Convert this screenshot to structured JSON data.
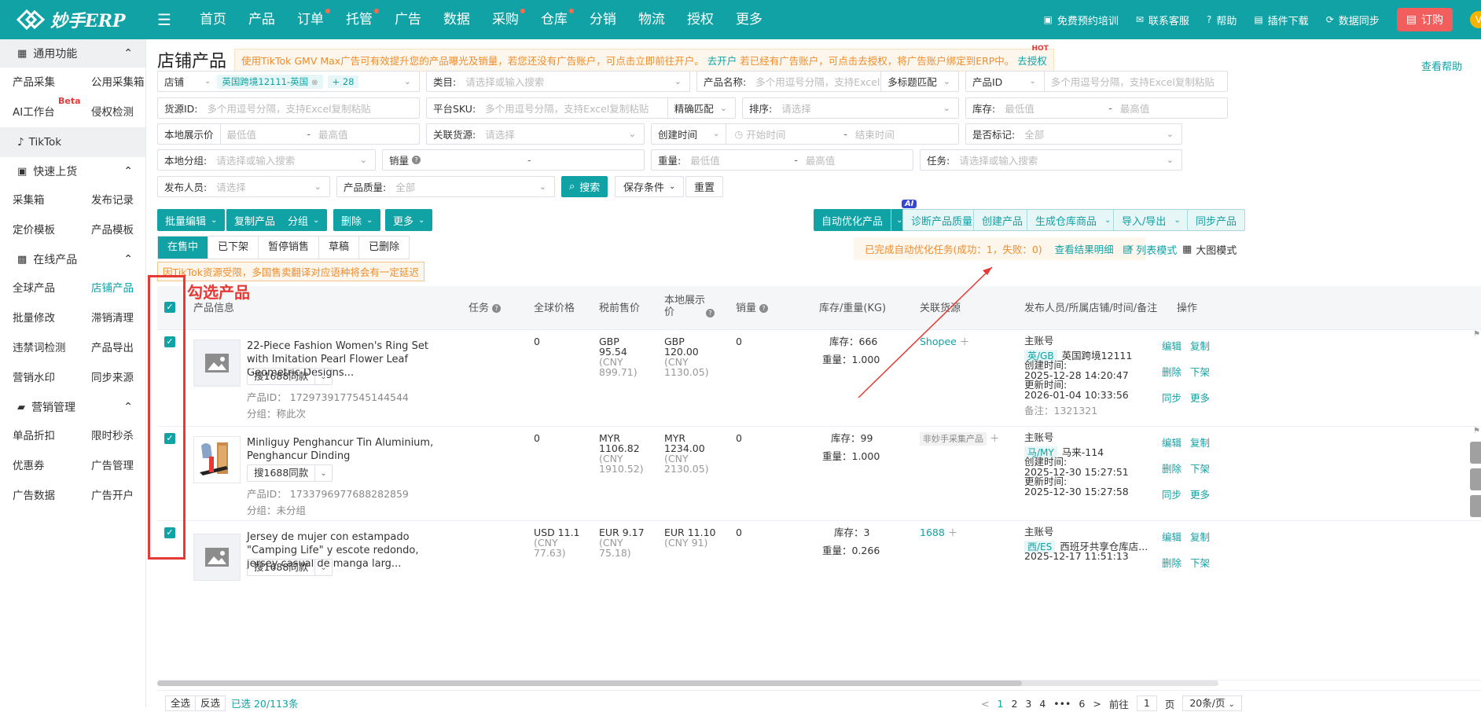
{
  "brand": {
    "name": "妙手ERP"
  },
  "nav": [
    {
      "label": "首页",
      "dot": false
    },
    {
      "label": "产品",
      "dot": false
    },
    {
      "label": "订单",
      "dot": true
    },
    {
      "label": "托管",
      "dot": true
    },
    {
      "label": "广告",
      "dot": false
    },
    {
      "label": "数据",
      "dot": false
    },
    {
      "label": "采购",
      "dot": true
    },
    {
      "label": "仓库",
      "dot": true
    },
    {
      "label": "分销",
      "dot": false
    },
    {
      "label": "物流",
      "dot": false
    },
    {
      "label": "授权",
      "dot": false
    },
    {
      "label": "更多",
      "dot": false
    }
  ],
  "top_right": {
    "training": "免费预约培训",
    "service": "联系客服",
    "help": "帮助",
    "plugin": "插件下载",
    "sync": "数据同步",
    "order": "订购",
    "avatar": "V"
  },
  "sidebar": {
    "common": "通用功能",
    "common_items": [
      "产品采集",
      "公用采集箱",
      "AI工作台",
      "侵权检测"
    ],
    "beta": "Beta",
    "platform": "TikTok",
    "quick": "快速上货",
    "quick_items": [
      "采集箱",
      "发布记录",
      "定价模板",
      "产品模板"
    ],
    "online": "在线产品",
    "online_items": [
      "全球产品",
      "店铺产品",
      "批量修改",
      "滞销清理",
      "违禁词检测",
      "产品导出",
      "营销水印",
      "同步来源"
    ],
    "marketing": "营销管理",
    "marketing_items": [
      "单品折扣",
      "限时秒杀",
      "优惠券",
      "广告管理",
      "广告数据",
      "广告开户"
    ]
  },
  "page": {
    "title": "店铺产品",
    "banner_pre": "使用TikTok GMV Max广告可有效提升您的产品曝光及销量，若您还没有广告账户，可点击立即前往开户。",
    "banner_link1": "去开户",
    "banner_mid": " 若已经有广告账户，可点击去授权，将广告账户绑定到ERP中。",
    "banner_link2": "去授权",
    "hot": "HOT",
    "view_help": "查看帮助"
  },
  "filters": {
    "shop": {
      "label": "店铺",
      "tag": "英国跨境12111-英国",
      "more": "+ 28"
    },
    "category": {
      "label": "类目:",
      "placeholder": "请选择或输入搜索"
    },
    "product_name": {
      "label": "产品名称:",
      "placeholder": "多个用逗号分隔，支持Excel复制粘",
      "mode": "多标题匹配"
    },
    "product_id": {
      "label": "产品ID",
      "placeholder": "多个用逗号分隔，支持Excel复制粘贴"
    },
    "source_id": {
      "label": "货源ID:",
      "placeholder": "多个用逗号分隔，支持Excel复制粘贴"
    },
    "platform_sku": {
      "label": "平台SKU:",
      "placeholder": "多个用逗号分隔，支持Excel复制粘贴",
      "mode": "精确匹配"
    },
    "sort": {
      "label": "排序:",
      "placeholder": "请选择"
    },
    "stock": {
      "label": "库存:",
      "min": "最低值",
      "max": "最高值"
    },
    "local_price": {
      "label": "本地展示价",
      "min": "最低值",
      "max": "最高值"
    },
    "linked_source": {
      "label": "关联货源:",
      "placeholder": "请选择"
    },
    "created_time": {
      "label": "创建时间",
      "start": "开始时间",
      "end": "结束时间"
    },
    "marked": {
      "label": "是否标记:",
      "value": "全部"
    },
    "local_group": {
      "label": "本地分组:",
      "placeholder": "请选择或输入搜索"
    },
    "sales": {
      "label": "销量"
    },
    "weight": {
      "label": "重量:",
      "min": "最低值",
      "max": "最高值"
    },
    "task": {
      "label": "任务:",
      "placeholder": "请选择或输入搜索"
    },
    "publisher": {
      "label": "发布人员:",
      "placeholder": "请选择"
    },
    "quality": {
      "label": "产品质量:",
      "value": "全部"
    },
    "search_btn": "搜索",
    "save_cond": "保存条件",
    "reset": "重置"
  },
  "actions": {
    "batch_edit": "批量编辑",
    "copy": "复制产品",
    "group": "分组",
    "delete": "删除",
    "more": "更多",
    "auto_opt": "自动优化产品",
    "ai": "AI",
    "diagnose": "诊断产品质量",
    "create": "创建产品",
    "gen_wh": "生成仓库商品",
    "import_export": "导入/导出",
    "sync_product": "同步产品"
  },
  "tabs": [
    "在售中",
    "已下架",
    "暂停销售",
    "草稿",
    "已删除"
  ],
  "notice": "因TikTok资源受限，多国售卖翻译对应语种将会有一定延迟",
  "done_msg": {
    "text": "已完成自动优化任务(成功：1，失败：0)",
    "link": "查看结果明细"
  },
  "modes": {
    "list": "列表模式",
    "large": "大图模式"
  },
  "annotation": {
    "label": "勾选产品"
  },
  "columns": {
    "info": "产品信息",
    "task": "任务",
    "global_price": "全球价格",
    "pre_tax": "税前售价",
    "local_price_1": "本地展示",
    "local_price_2": "价",
    "sales": "销量",
    "stock_weight": "库存/重量(KG)",
    "source": "关联货源",
    "publisher": "发布人员/所属店铺/时间/备注",
    "ops": "操作"
  },
  "rows": [
    {
      "name": "22-Piece Fashion Women's Ring Set with Imitation Pearl Flower Leaf Geometric Designs...",
      "search": "搜1688同款",
      "product_id": "产品ID： 1729739177545144544",
      "group": "分组：称此次",
      "task": "0",
      "global_price": "",
      "pre_tax_1": "GBP",
      "pre_tax_2": "95.54",
      "pre_tax_3": "(CNY",
      "pre_tax_4": "899.71)",
      "local_1": "GBP",
      "local_2": "120.00",
      "local_3": "(CNY",
      "local_4": "1130.05)",
      "sales": "0",
      "stock": "库存：666",
      "weight": "重量：1.000",
      "source": "Shopee",
      "publisher": "主账号",
      "region": "英/GB",
      "shop": "英国跨境12111",
      "created_label": "创建时间:",
      "created": "2025-12-28 14:20:47",
      "updated_label": "更新时间:",
      "updated": "2026-01-04 10:33:56",
      "remark": "备注：1321321"
    },
    {
      "name": "Minliguy Penghancur Tin Aluminium, Penghancur Dinding",
      "search": "搜1688同款",
      "product_id": "产品ID： 1733796977688282859",
      "group": "分组：未分组",
      "task": "0",
      "pre_tax_1": "MYR",
      "pre_tax_2": "1106.82",
      "pre_tax_3": "(CNY",
      "pre_tax_4": "1910.52)",
      "local_1": "MYR",
      "local_2": "1234.00",
      "local_3": "(CNY",
      "local_4": "2130.05)",
      "sales": "0",
      "stock": "库存：99",
      "weight": "重量：1.000",
      "source": "非妙手采集产品",
      "publisher": "主账号",
      "region": "马/MY",
      "shop": "马来-114",
      "created_label": "创建时间:",
      "created": "2025-12-30 15:27:51",
      "updated_label": "更新时间:",
      "updated": "2025-12-30 15:27:58"
    },
    {
      "name": "Jersey de mujer con estampado \"Camping Life\" y escote redondo, jersey casual de manga larg...",
      "search": "搜1688同款",
      "global_1": "USD 11.1",
      "global_2": "(CNY",
      "global_3": "77.63)",
      "pre_tax_1": "EUR 9.17",
      "pre_tax_2": "(CNY",
      "pre_tax_3": "75.18)",
      "local_1": "EUR 11.10",
      "local_2": "(CNY 91)",
      "sales": "0",
      "stock": "库存：3",
      "weight": "重量：0.266",
      "source": "1688",
      "publisher": "主账号",
      "region": "西/ES",
      "shop": "西班牙共享仓库店...",
      "created": "2025-12-17 11:51:13"
    }
  ],
  "ops": {
    "edit": "编辑",
    "copy": "复制",
    "delete": "删除",
    "unlist": "下架",
    "sync": "同步",
    "more": "更多"
  },
  "footer": {
    "select_all": "全选",
    "invert": "反选",
    "selected": "已选 20/113条",
    "pages": [
      "1",
      "2",
      "3",
      "4",
      "•••",
      "6"
    ],
    "prev": "<",
    "next": ">",
    "goto": "前往",
    "page_no": "1",
    "page_unit": "页",
    "per_page": "20条/页"
  },
  "colors": {
    "primary": "#11a2a5",
    "annotation": "#e53935",
    "warning": "#f08c2a"
  }
}
